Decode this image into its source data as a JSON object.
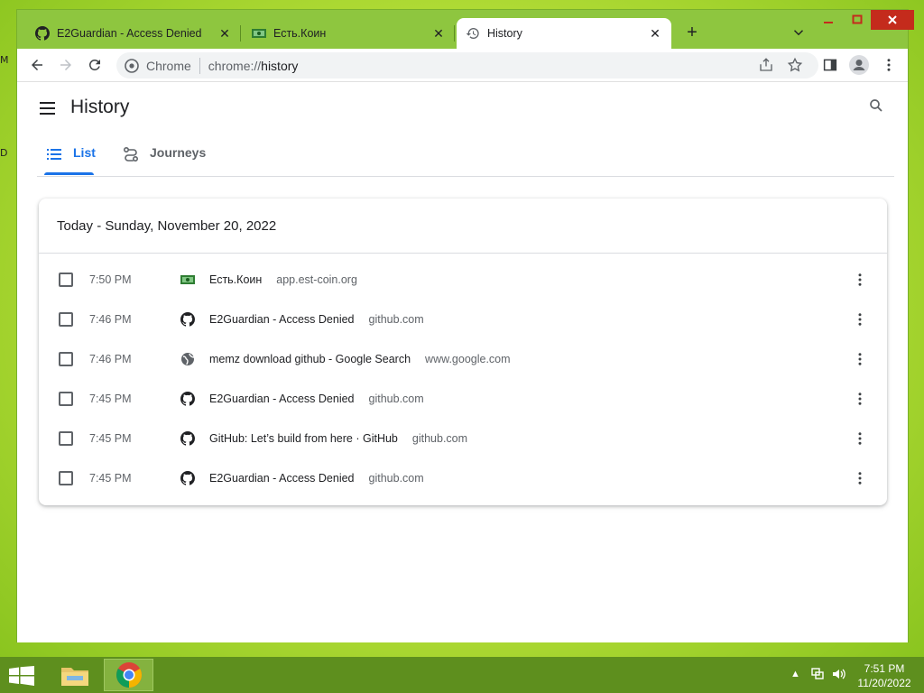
{
  "desktop": {
    "edge_letter_1": "M",
    "edge_letter_2": "D"
  },
  "tabs": [
    {
      "title": "E2Guardian - Access Denied",
      "icon": "github-icon"
    },
    {
      "title": "Есть.Коин",
      "icon": "coin-favicon"
    },
    {
      "title": "History",
      "icon": "history-icon"
    }
  ],
  "omnibox": {
    "chip": "Chrome",
    "url_scheme": "chrome://",
    "url_path": "history"
  },
  "history": {
    "title": "History",
    "tabs": {
      "list": "List",
      "journeys": "Journeys"
    },
    "card_title": "Today - Sunday, November 20, 2022",
    "entries": [
      {
        "time": "7:50 PM",
        "title": "Есть.Коин",
        "domain": "app.est-coin.org",
        "icon": "coin-favicon"
      },
      {
        "time": "7:46 PM",
        "title": "E2Guardian - Access Denied",
        "domain": "github.com",
        "icon": "github-icon"
      },
      {
        "time": "7:46 PM",
        "title": "memz download github - Google Search",
        "domain": "www.google.com",
        "icon": "globe-icon"
      },
      {
        "time": "7:45 PM",
        "title": "E2Guardian - Access Denied",
        "domain": "github.com",
        "icon": "github-icon"
      },
      {
        "time": "7:45 PM",
        "title": "GitHub: Let’s build from here · GitHub",
        "domain": "github.com",
        "icon": "github-icon"
      },
      {
        "time": "7:45 PM",
        "title": "E2Guardian - Access Denied",
        "domain": "github.com",
        "icon": "github-icon"
      }
    ]
  },
  "taskbar": {
    "time": "7:51 PM",
    "date": "11/20/2022"
  },
  "colors": {
    "accent": "#1a73e8",
    "frame": "#8ec63f",
    "taskbar": "#5e8f1e",
    "close": "#c42b1c"
  }
}
